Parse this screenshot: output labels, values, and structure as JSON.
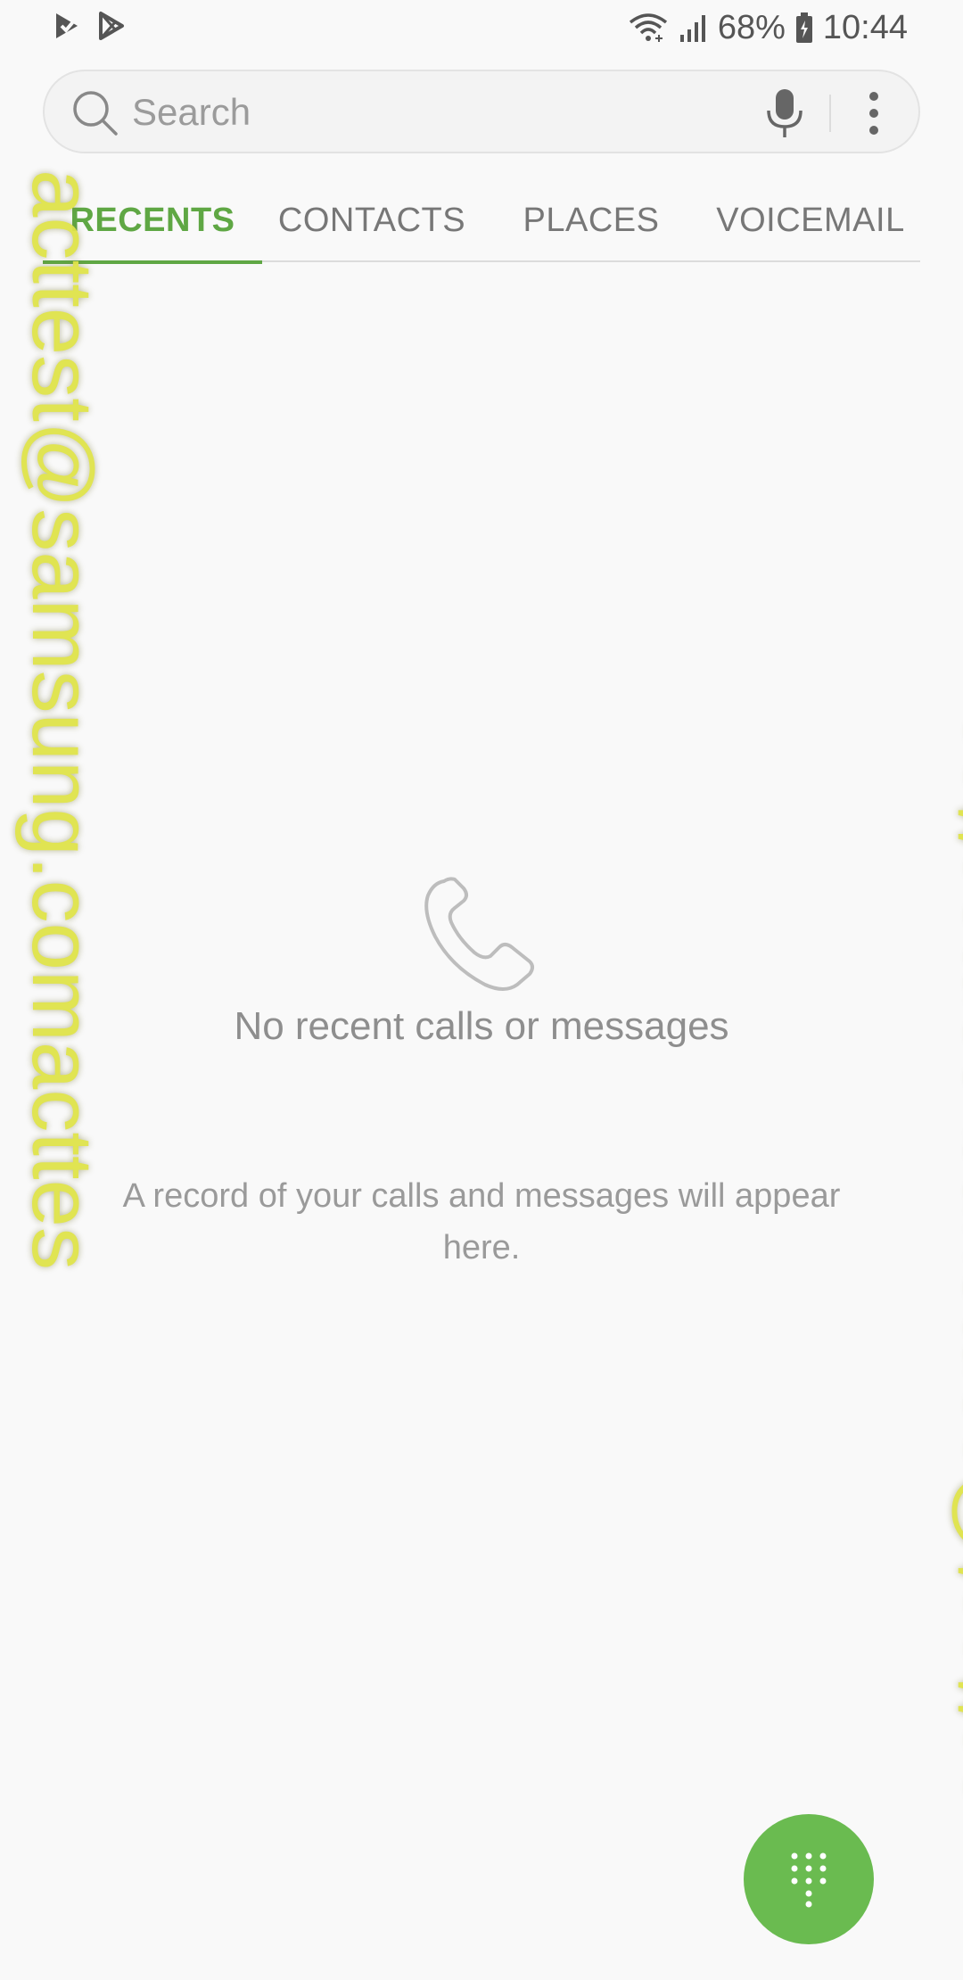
{
  "status_bar": {
    "battery": "68%",
    "time": "10:44",
    "left_icons": [
      "play-store-check-icon",
      "play-store-icon"
    ],
    "right_icons": [
      "wifi-icon",
      "signal-icon",
      "battery-icon"
    ]
  },
  "search": {
    "placeholder": "Search",
    "value": ""
  },
  "tabs": [
    {
      "label": "RECENTS",
      "active": true
    },
    {
      "label": "CONTACTS",
      "active": false
    },
    {
      "label": "PLACES",
      "active": false
    },
    {
      "label": "VOICEMAIL",
      "active": false
    }
  ],
  "empty_state": {
    "icon": "phone-icon",
    "title": "No recent calls or messages",
    "description": "A record of your calls and messages will appear here."
  },
  "watermark": {
    "left_text": "acttest@samsung.comacttes",
    "right_text": "acttest@samsung.comacttes"
  },
  "fab": {
    "icon": "dialpad-icon"
  },
  "colors": {
    "accent": "#5fa744",
    "fab": "#6abb50",
    "background": "#f9f9f9",
    "watermark": "#dfe34a"
  }
}
